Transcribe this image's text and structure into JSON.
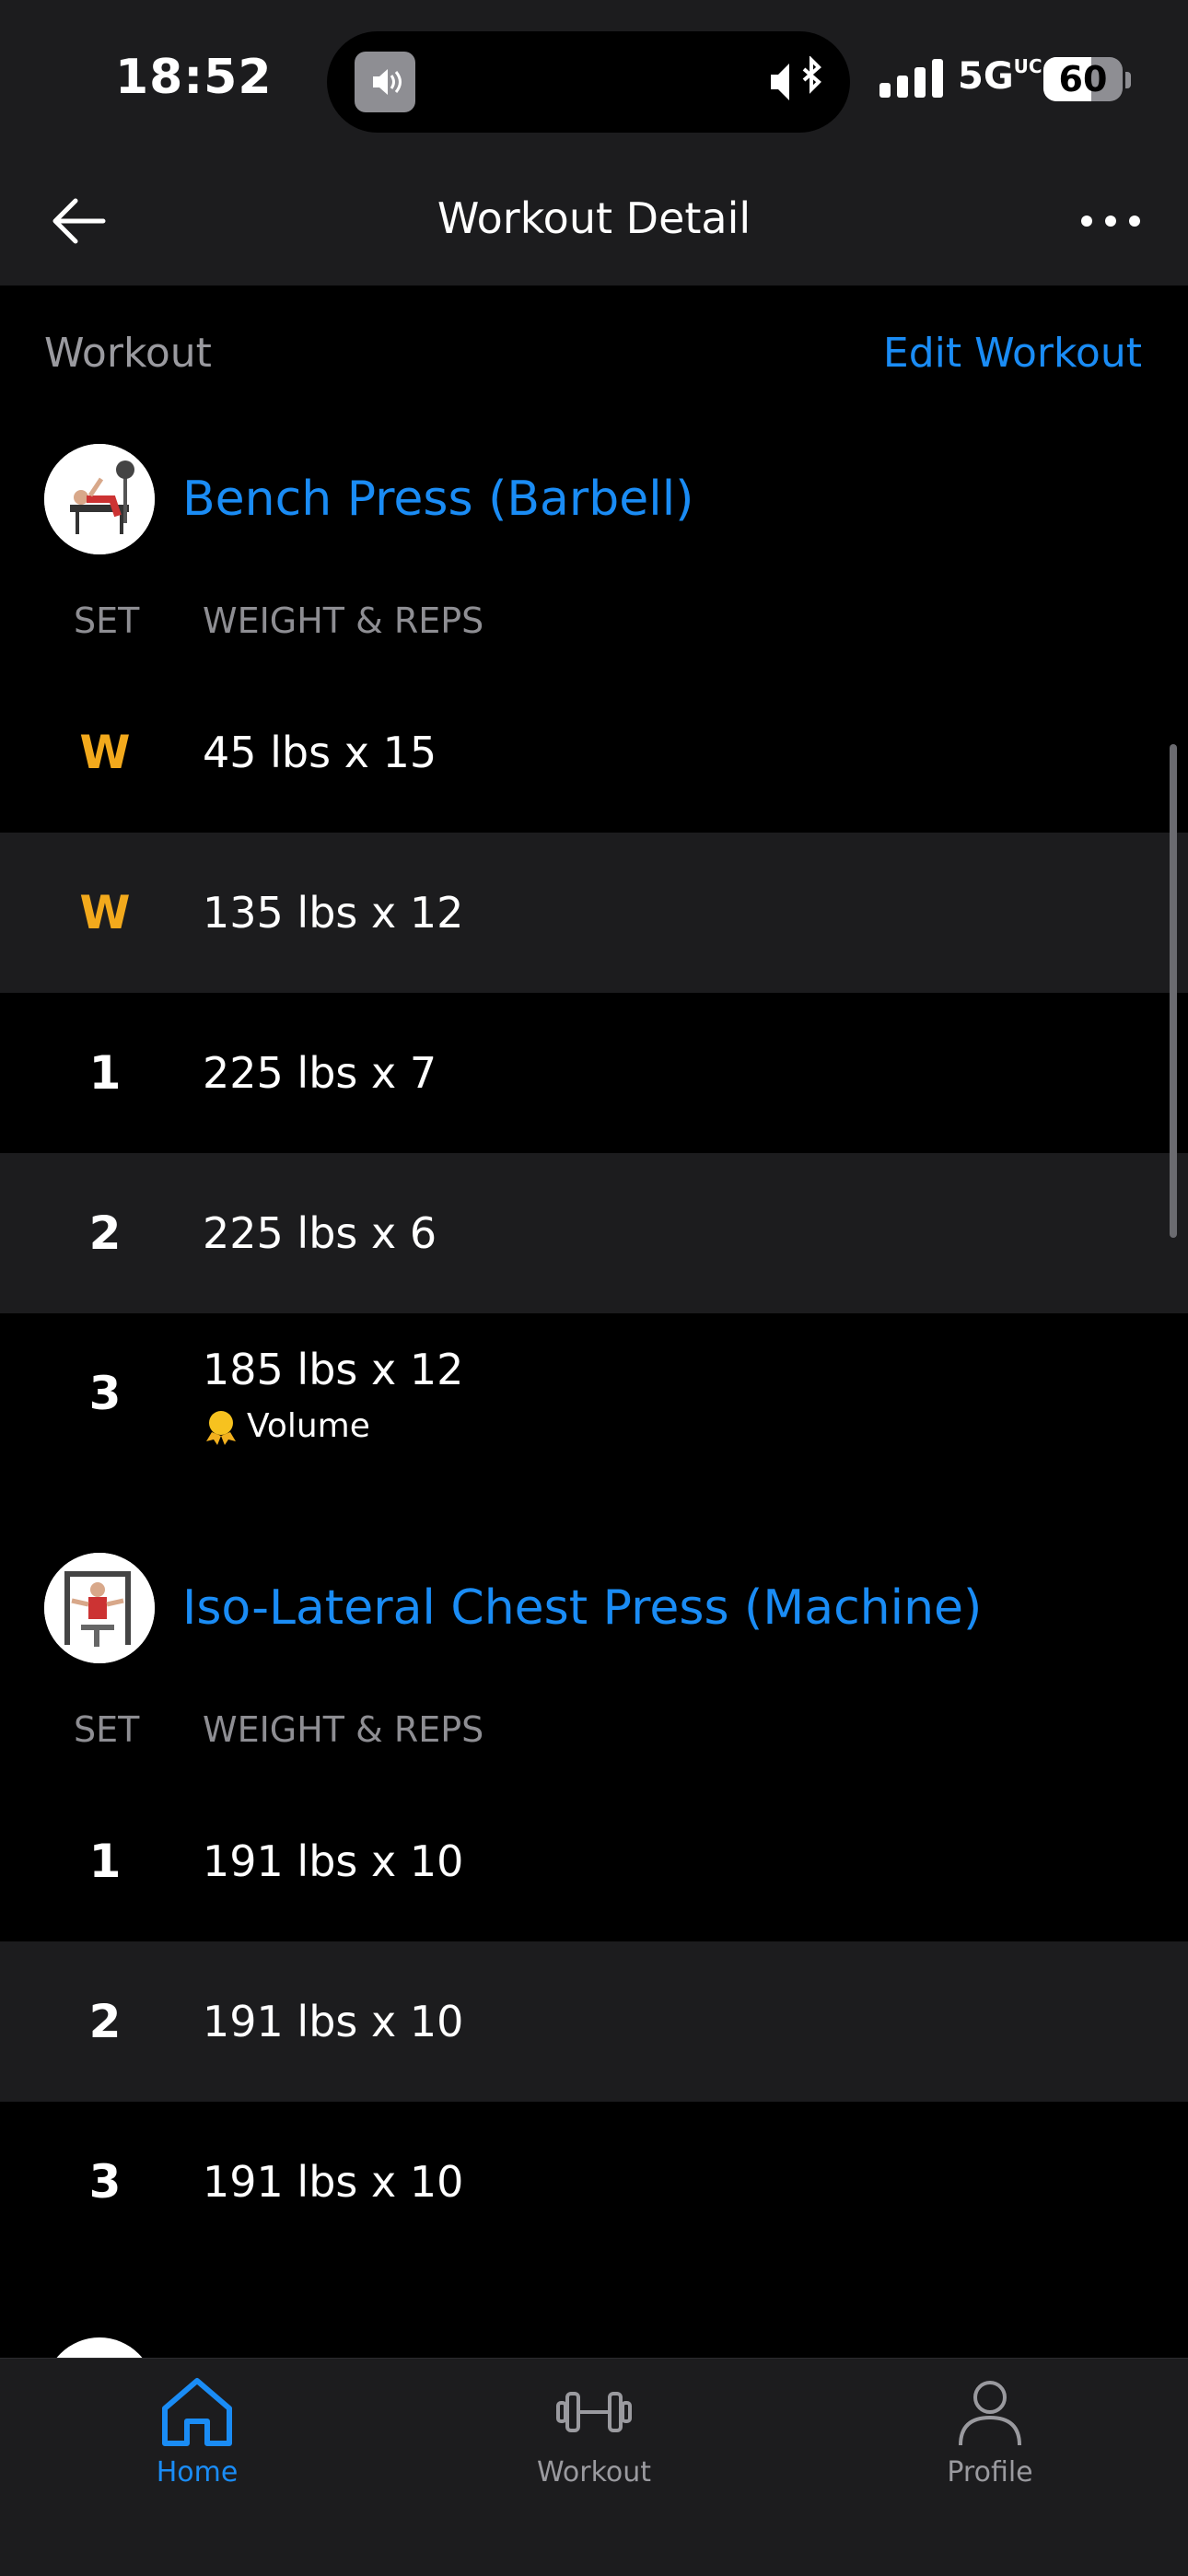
{
  "status_bar": {
    "time": "18:52",
    "network": "5G",
    "network_suffix": "UC",
    "battery": "60",
    "battery_level": 0.6
  },
  "nav": {
    "title": "Workout Detail"
  },
  "section": {
    "label": "Workout",
    "edit_label": "Edit Workout"
  },
  "exercises": [
    {
      "name": "Bench Press (Barbell)",
      "col_set": "SET",
      "col_weight_reps": "WEIGHT & REPS",
      "sets": [
        {
          "set": "W",
          "value": "45 lbs x 15"
        },
        {
          "set": "W",
          "value": "135 lbs x 12"
        },
        {
          "set": "1",
          "value": "225 lbs x 7"
        },
        {
          "set": "2",
          "value": "225 lbs x 6"
        },
        {
          "set": "3",
          "value": "185 lbs x 12",
          "record": "Volume"
        }
      ]
    },
    {
      "name": "Iso-Lateral Chest Press (Machine)",
      "col_set": "SET",
      "col_weight_reps": "WEIGHT & REPS",
      "sets": [
        {
          "set": "1",
          "value": "191 lbs x 10"
        },
        {
          "set": "2",
          "value": "191 lbs x 10"
        },
        {
          "set": "3",
          "value": "191 lbs x 10"
        }
      ]
    }
  ],
  "tabs": [
    {
      "label": "Home",
      "icon": "home-icon",
      "active": true
    },
    {
      "label": "Workout",
      "icon": "dumbbell-icon",
      "active": false
    },
    {
      "label": "Profile",
      "icon": "profile-icon",
      "active": false
    }
  ],
  "colors": {
    "accent": "#1a8cf5",
    "warmup": "#f2a91c",
    "surface": "#1c1c1e"
  }
}
